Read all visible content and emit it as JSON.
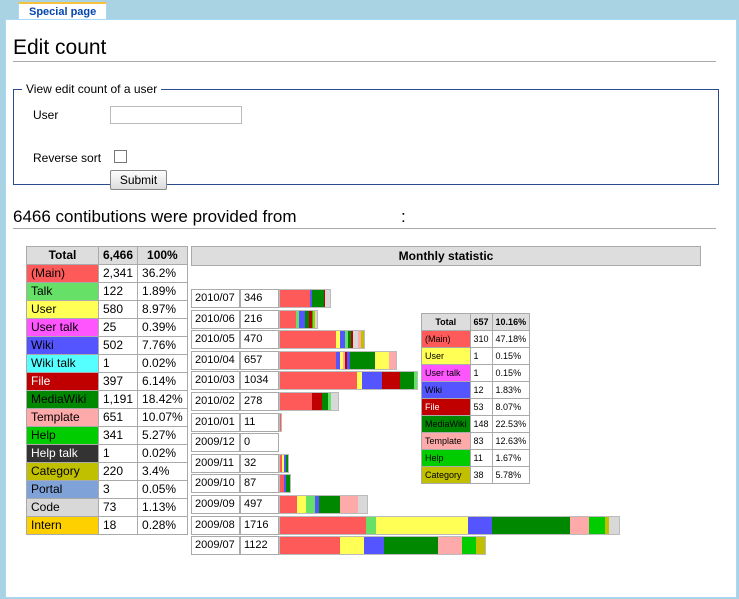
{
  "tab_label": "Special page",
  "page_title": "Edit count",
  "form": {
    "legend": "View edit count of a user",
    "user_label": "User",
    "user_value": "",
    "reverse_label": "Reverse sort",
    "submit_label": "Submit"
  },
  "contrib_heading": "6466 contibutions were provided from",
  "contrib_colon": ":",
  "colors": {
    "main": "#ff5a5a",
    "talk": "#66e066",
    "user": "#ffff55",
    "user_talk": "#ff55ff",
    "wiki": "#5555ff",
    "wiki_talk": "#55ffff",
    "file": "#c00000",
    "mediawiki": "#008800",
    "template": "#ffaaaa",
    "help": "#00cc00",
    "help_talk": "#333333",
    "category": "#c0c000",
    "portal": "#7fa3d8",
    "code": "#d8d8d8",
    "intern": "#ffd000"
  },
  "namespace_table": {
    "headers": [
      "Total",
      "6,466",
      "100%"
    ],
    "rows": [
      {
        "name": "(Main)",
        "count": "2,341",
        "pct": "36.2%",
        "color": "#ff5a5a"
      },
      {
        "name": "Talk",
        "count": "122",
        "pct": "1.89%",
        "color": "#66e066"
      },
      {
        "name": "User",
        "count": "580",
        "pct": "8.97%",
        "color": "#ffff55"
      },
      {
        "name": "User talk",
        "count": "25",
        "pct": "0.39%",
        "color": "#ff55ff"
      },
      {
        "name": "Wiki",
        "count": "502",
        "pct": "7.76%",
        "color": "#5555ff"
      },
      {
        "name": "Wiki talk",
        "count": "1",
        "pct": "0.02%",
        "color": "#55ffff"
      },
      {
        "name": "File",
        "count": "397",
        "pct": "6.14%",
        "color": "#c00000"
      },
      {
        "name": "MediaWiki",
        "count": "1,191",
        "pct": "18.42%",
        "color": "#008800"
      },
      {
        "name": "Template",
        "count": "651",
        "pct": "10.07%",
        "color": "#ffaaaa"
      },
      {
        "name": "Help",
        "count": "341",
        "pct": "5.27%",
        "color": "#00cc00"
      },
      {
        "name": "Help talk",
        "count": "1",
        "pct": "0.02%",
        "color": "#333333"
      },
      {
        "name": "Category",
        "count": "220",
        "pct": "3.4%",
        "color": "#c0c000"
      },
      {
        "name": "Portal",
        "count": "3",
        "pct": "0.05%",
        "color": "#7fa3d8"
      },
      {
        "name": "Code",
        "count": "73",
        "pct": "1.13%",
        "color": "#d8d8d8"
      },
      {
        "name": "Intern",
        "count": "18",
        "pct": "0.28%",
        "color": "#ffd000"
      }
    ]
  },
  "monthly": {
    "title": "Monthly statistic",
    "rows": [
      {
        "month": "2010/07",
        "count": "346",
        "segments": [
          [
            "main",
            30
          ],
          [
            "wiki",
            2
          ],
          [
            "mediawiki",
            12
          ],
          [
            "file",
            1
          ],
          [
            "code",
            5
          ]
        ]
      },
      {
        "month": "2010/06",
        "count": "216",
        "segments": [
          [
            "main",
            16
          ],
          [
            "talk",
            3
          ],
          [
            "wiki",
            6
          ],
          [
            "mediawiki",
            4
          ],
          [
            "file",
            3
          ],
          [
            "help",
            1
          ],
          [
            "category",
            2
          ],
          [
            "code",
            2
          ]
        ]
      },
      {
        "month": "2010/05",
        "count": "470",
        "segments": [
          [
            "main",
            56
          ],
          [
            "user",
            4
          ],
          [
            "wiki",
            5
          ],
          [
            "talk",
            3
          ],
          [
            "mediawiki",
            3
          ],
          [
            "file",
            2
          ],
          [
            "code",
            5
          ],
          [
            "template",
            3
          ],
          [
            "category",
            3
          ]
        ]
      },
      {
        "month": "2010/04",
        "count": "657",
        "segments": [
          [
            "main",
            56
          ],
          [
            "wiki",
            4
          ],
          [
            "user",
            3
          ],
          [
            "template",
            2
          ],
          [
            "file",
            2
          ],
          [
            "wiki",
            3
          ],
          [
            "mediawiki",
            25
          ],
          [
            "user",
            14
          ],
          [
            "template",
            7
          ]
        ]
      },
      {
        "month": "2010/03",
        "count": "1034",
        "segments": [
          [
            "main",
            77
          ],
          [
            "user",
            5
          ],
          [
            "wiki",
            20
          ],
          [
            "file",
            18
          ],
          [
            "mediawiki",
            14
          ],
          [
            "talk",
            3
          ]
        ]
      },
      {
        "month": "2010/02",
        "count": "278",
        "segments": [
          [
            "main",
            32
          ],
          [
            "file",
            10
          ],
          [
            "mediawiki",
            6
          ],
          [
            "talk",
            3
          ],
          [
            "code",
            7
          ]
        ]
      },
      {
        "month": "2010/01",
        "count": "11",
        "segments": [
          [
            "main",
            1
          ]
        ]
      },
      {
        "month": "2009/12",
        "count": "0",
        "segments": []
      },
      {
        "month": "2009/11",
        "count": "32",
        "segments": [
          [
            "main",
            2
          ],
          [
            "user",
            2
          ],
          [
            "wiki",
            2
          ],
          [
            "mediawiki",
            2
          ]
        ]
      },
      {
        "month": "2009/10",
        "count": "87",
        "segments": [
          [
            "main",
            4
          ],
          [
            "wiki",
            2
          ],
          [
            "mediawiki",
            4
          ]
        ]
      },
      {
        "month": "2009/09",
        "count": "497",
        "segments": [
          [
            "main",
            17
          ],
          [
            "user",
            9
          ],
          [
            "talk",
            9
          ],
          [
            "wiki",
            4
          ],
          [
            "mediawiki",
            21
          ],
          [
            "template",
            18
          ],
          [
            "code",
            9
          ]
        ]
      },
      {
        "month": "2009/08",
        "count": "1716",
        "segments": [
          [
            "main",
            86
          ],
          [
            "talk",
            10
          ],
          [
            "user",
            92
          ],
          [
            "wiki",
            24
          ],
          [
            "mediawiki",
            78
          ],
          [
            "template",
            19
          ],
          [
            "help",
            16
          ],
          [
            "category",
            4
          ],
          [
            "code",
            10
          ]
        ]
      },
      {
        "month": "2009/07",
        "count": "1122",
        "segments": [
          [
            "main",
            60
          ],
          [
            "user",
            24
          ],
          [
            "wiki",
            20
          ],
          [
            "mediawiki",
            54
          ],
          [
            "template",
            24
          ],
          [
            "help",
            14
          ],
          [
            "category",
            9
          ]
        ]
      }
    ]
  },
  "detail_table": {
    "headers": [
      "Total",
      "657",
      "10.16%"
    ],
    "rows": [
      {
        "name": "(Main)",
        "count": "310",
        "pct": "47.18%",
        "color": "#ff5a5a"
      },
      {
        "name": "User",
        "count": "1",
        "pct": "0.15%",
        "color": "#ffff55"
      },
      {
        "name": "User talk",
        "count": "1",
        "pct": "0.15%",
        "color": "#ff55ff"
      },
      {
        "name": "Wiki",
        "count": "12",
        "pct": "1.83%",
        "color": "#5555ff"
      },
      {
        "name": "File",
        "count": "53",
        "pct": "8.07%",
        "color": "#c00000"
      },
      {
        "name": "MediaWiki",
        "count": "148",
        "pct": "22.53%",
        "color": "#008800"
      },
      {
        "name": "Template",
        "count": "83",
        "pct": "12.63%",
        "color": "#ffaaaa"
      },
      {
        "name": "Help",
        "count": "11",
        "pct": "1.67%",
        "color": "#00cc00"
      },
      {
        "name": "Category",
        "count": "38",
        "pct": "5.78%",
        "color": "#c0c000"
      }
    ]
  }
}
